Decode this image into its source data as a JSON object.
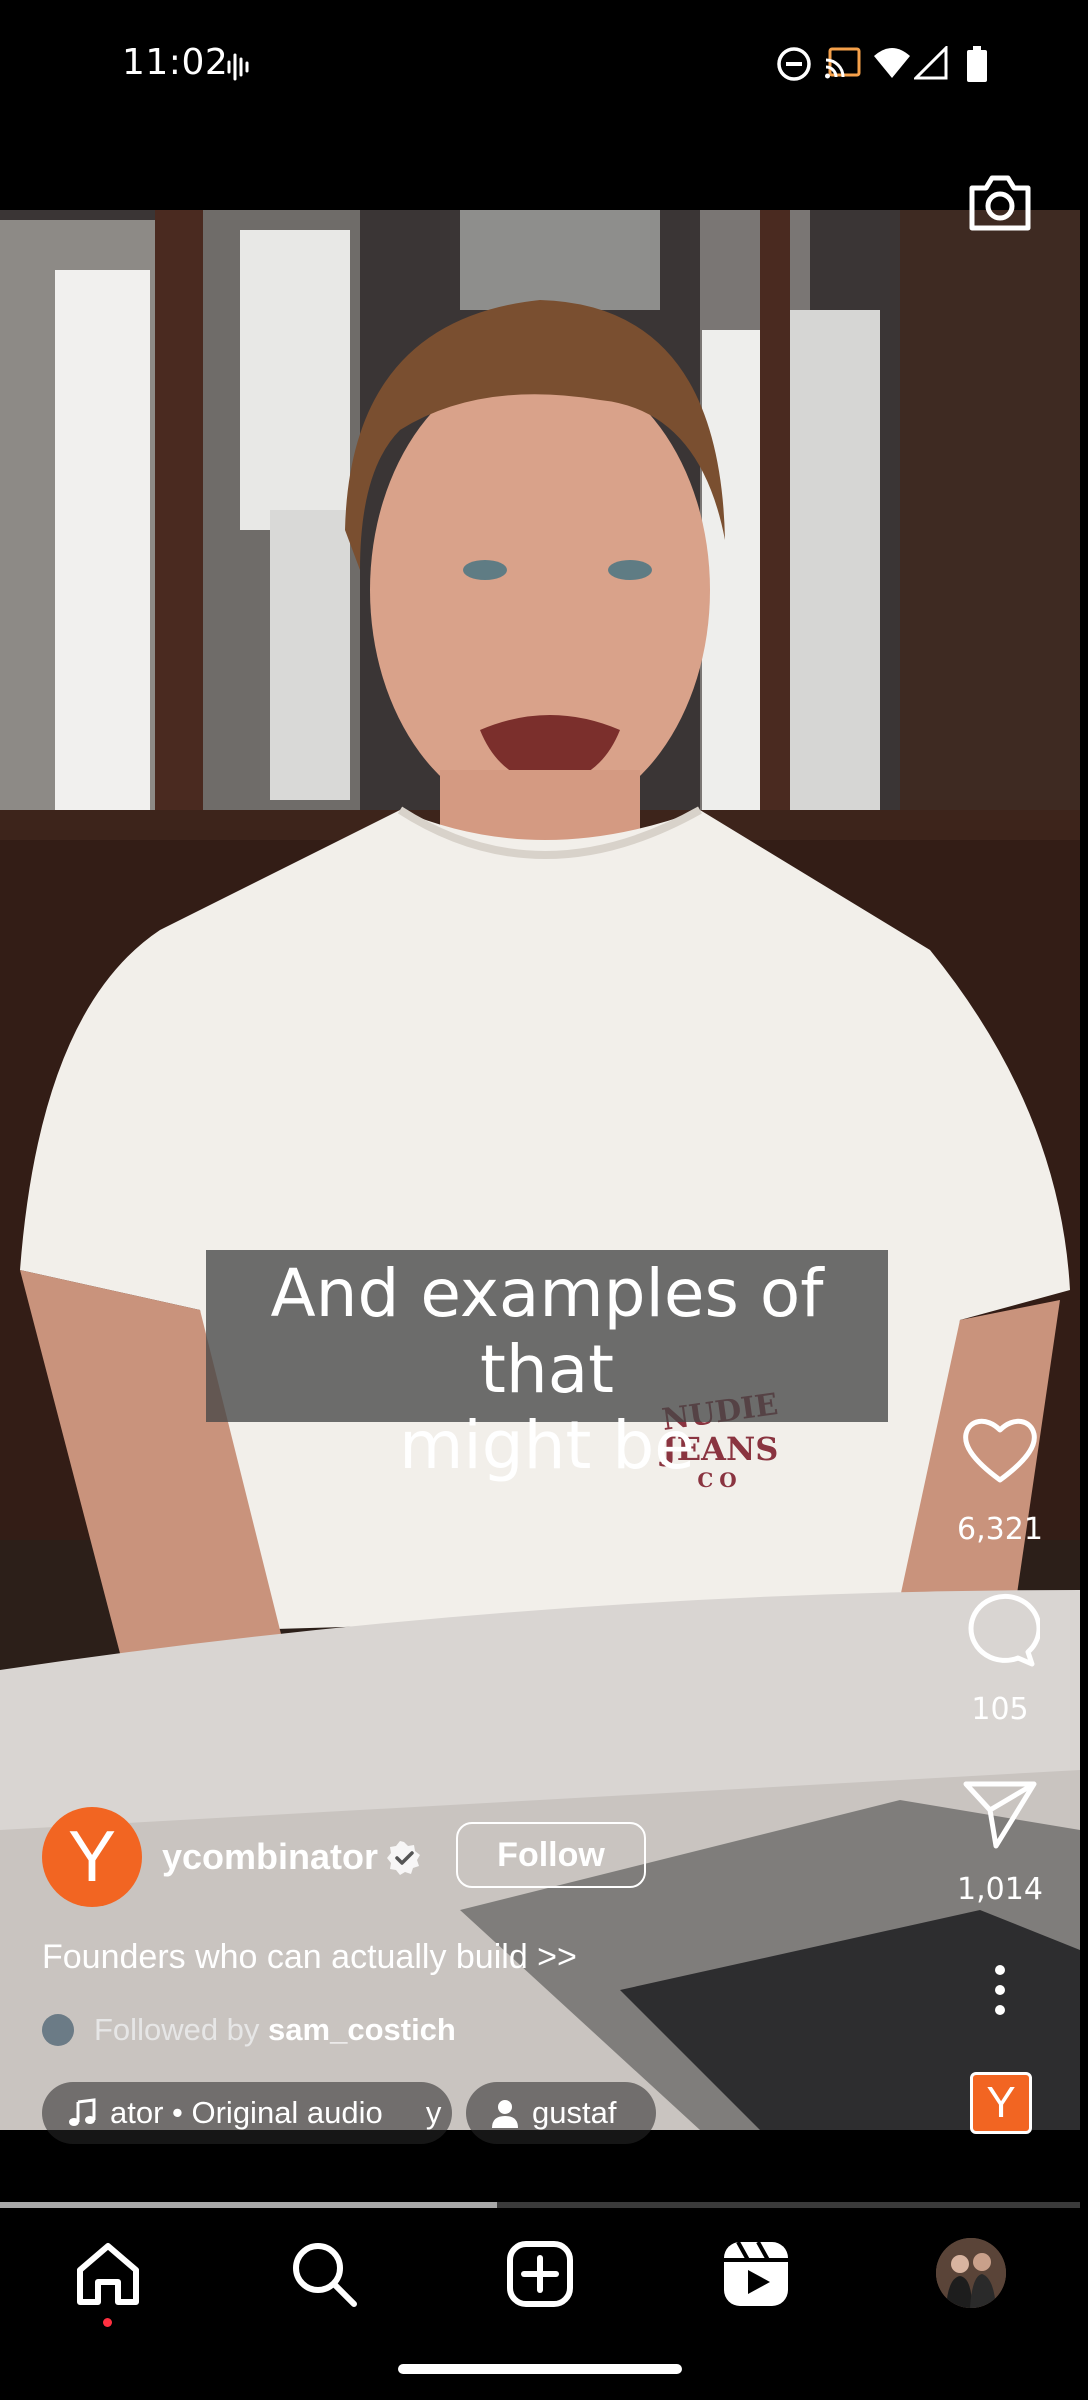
{
  "status_bar": {
    "time": "11:02",
    "icons": [
      "voicemail-wave-icon",
      "do-not-disturb-icon",
      "cast-icon",
      "wifi-icon",
      "signal-icon",
      "battery-icon"
    ]
  },
  "video": {
    "subtitle_line1": "And examples of that",
    "subtitle_line2": "might be",
    "shirt_logo": [
      "NUDIE",
      "JEANS",
      "CO"
    ]
  },
  "actions": {
    "likes": "6,321",
    "comments": "105",
    "shares": "1,014"
  },
  "post": {
    "avatar_letter": "Y",
    "username": "ycombinator",
    "follow_label": "Follow",
    "caption": "Founders who can actually build >>",
    "followed_by_prefix": "Followed by",
    "followed_by_user": "sam_costich",
    "audio_label": "ator • Original audio     y",
    "tagged_user": "gustaf",
    "mini_logo_letter": "Y"
  },
  "progress": {
    "fraction": 0.46
  },
  "nav": {
    "items": [
      "home-icon",
      "search-icon",
      "create-icon",
      "reels-icon",
      "profile-avatar"
    ],
    "active": "home-icon"
  },
  "colors": {
    "brand_orange": "#f26522",
    "notification_dot": "#ff3040",
    "caption_bg": "#464646"
  }
}
